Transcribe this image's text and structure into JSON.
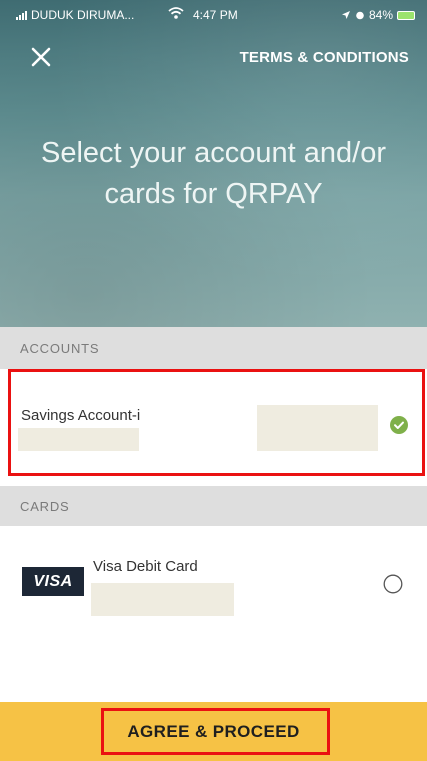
{
  "status_bar": {
    "carrier": "DUDUK DIRUMA...",
    "time": "4:47 PM",
    "battery": "84%"
  },
  "top_bar": {
    "close_icon": "close-icon",
    "terms_label": "TERMS & CONDITIONS"
  },
  "hero": {
    "title": "Select your account and/or cards for QRPAY"
  },
  "accounts": {
    "header": "ACCOUNTS",
    "items": [
      {
        "name": "Savings Account-i",
        "selected": true,
        "status_icon": "check-circle-icon"
      }
    ]
  },
  "cards": {
    "header": "CARDS",
    "items": [
      {
        "brand": "VISA",
        "name": "Visa Debit Card",
        "selected": false,
        "status_icon": "radio-empty-icon"
      }
    ]
  },
  "footer": {
    "agree_label": "AGREE & PROCEED"
  },
  "colors": {
    "accent_yellow": "#f6c245",
    "check_green": "#7fb04a",
    "section_gray": "#dedede",
    "visa_navy": "#1d2736",
    "highlight_red": "#ea1111"
  }
}
